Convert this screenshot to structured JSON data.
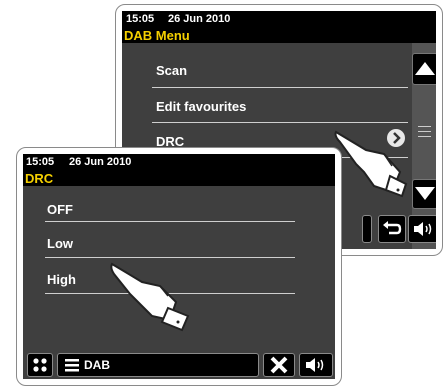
{
  "back_screen": {
    "time": "15:05",
    "date": "26 Jun 2010",
    "title": "DAB Menu",
    "items": [
      {
        "label": "Scan"
      },
      {
        "label": "Edit favourites"
      },
      {
        "label": "DRC"
      }
    ]
  },
  "front_screen": {
    "time": "15:05",
    "date": "26 Jun 2010",
    "title": "DRC",
    "items": [
      {
        "label": "OFF"
      },
      {
        "label": "Low"
      },
      {
        "label": "High"
      }
    ],
    "mode_label": "DAB"
  },
  "colors": {
    "title": "#f5d000",
    "screen_bg": "#3f3f3f",
    "bar_bg": "#000000"
  }
}
